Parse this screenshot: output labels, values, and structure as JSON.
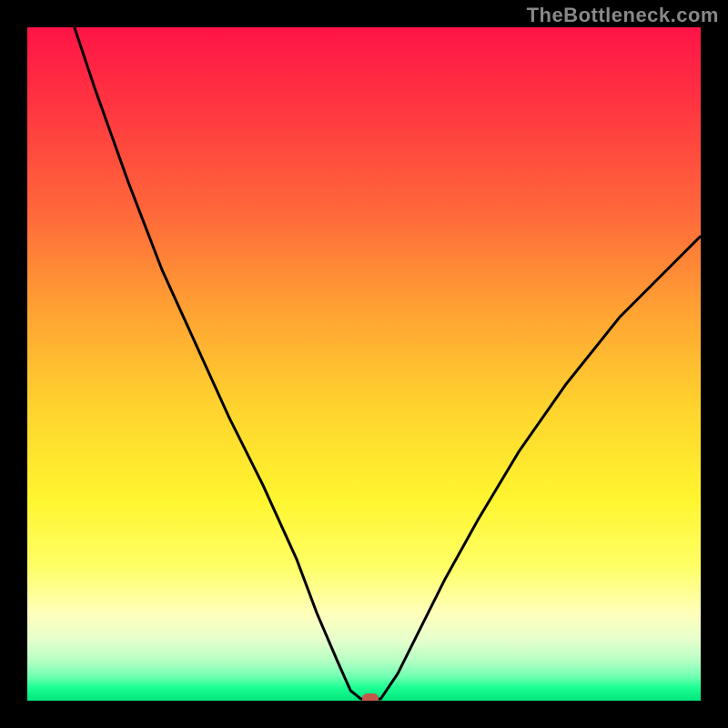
{
  "watermark": "TheBottleneck.com",
  "colors": {
    "frame": "#000000",
    "curve": "#000000",
    "marker": "#c15a4a",
    "gradient_top": "#ff1447",
    "gradient_bottom": "#00e77d"
  },
  "chart_data": {
    "type": "line",
    "title": "",
    "xlabel": "",
    "ylabel": "",
    "xlim": [
      0,
      100
    ],
    "ylim": [
      0,
      100
    ],
    "grid": false,
    "series": [
      {
        "name": "left-branch",
        "x": [
          7,
          10,
          15,
          20,
          25,
          30,
          35,
          40,
          43,
          46,
          48,
          49.5
        ],
        "values": [
          100,
          91,
          77,
          64,
          53,
          42,
          32,
          21,
          13,
          6,
          1.5,
          0.3
        ]
      },
      {
        "name": "valley",
        "x": [
          49.5,
          50.5,
          51.5,
          52.5
        ],
        "values": [
          0.3,
          0.15,
          0.15,
          0.3
        ]
      },
      {
        "name": "right-branch",
        "x": [
          52.5,
          55,
          58,
          62,
          67,
          73,
          80,
          88,
          96,
          100
        ],
        "values": [
          0.3,
          4,
          10,
          18,
          27,
          37,
          47,
          57,
          65,
          69
        ]
      }
    ],
    "marker": {
      "x": 51,
      "y": 0.3,
      "label": "notch-marker"
    },
    "annotations": []
  }
}
